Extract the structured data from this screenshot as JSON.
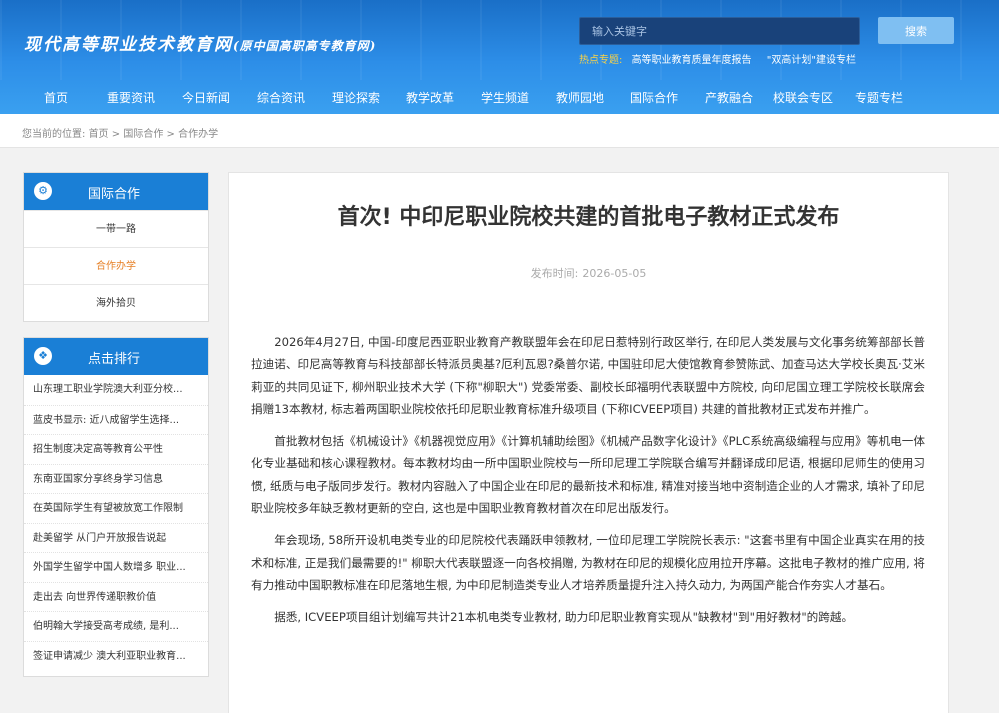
{
  "header": {
    "logo_main": "现代高等职业技术教育网",
    "logo_sub": "(原中国高职高专教育网)",
    "search": {
      "placeholder": "输入关键字",
      "button": "搜索"
    },
    "hot": {
      "label": "热点专题:",
      "links": [
        "高等职业教育质量年度报告",
        "\"双高计划\"建设专栏"
      ]
    },
    "nav": [
      "首页",
      "重要资讯",
      "今日新闻",
      "综合资讯",
      "理论探索",
      "教学改革",
      "学生频道",
      "教师园地",
      "国际合作",
      "产教融合",
      "校联会专区",
      "专题专栏"
    ]
  },
  "breadcrumb": {
    "prefix": "您当前的位置:",
    "items": [
      "首页",
      "国际合作",
      "合作办学"
    ],
    "sep": ">"
  },
  "sidebar": {
    "section1": {
      "icon": "settings-gear-icon",
      "title": "国际合作",
      "items": [
        "一带一路",
        "合作办学",
        "海外拾贝"
      ],
      "active": "合作办学"
    },
    "section2": {
      "icon": "ranking-icon",
      "title": "点击排行",
      "items": [
        "山东理工职业学院澳大利亚分校...",
        "蓝皮书显示: 近八成留学生选择...",
        "招生制度决定高等教育公平性",
        "东南亚国家分享终身学习信息",
        "在英国际学生有望被放宽工作限制",
        "赴美留学 从门户开放报告说起",
        "外国学生留学中国人数增多 职业...",
        "走出去 向世界传递职教价值",
        "伯明翰大学接受高考成绩, 是利...",
        "签证申请减少 澳大利亚职业教育..."
      ]
    }
  },
  "article": {
    "title": "首次! 中印尼职业院校共建的首批电子教材正式发布",
    "date_label": "发布时间:",
    "date": "2026-05-05",
    "paragraphs": [
      "2026年4月27日, 中国-印度尼西亚职业教育产教联盟年会在印尼日惹特别行政区举行, 在印尼人类发展与文化事务统筹部部长普拉迪诺、印尼高等教育与科技部部长特派员奥基?厄利瓦恩?桑普尔诺, 中国驻印尼大使馆教育参赞陈武、加查马达大学校长奥瓦·艾米莉亚的共同见证下, 柳州职业技术大学 (下称\"柳职大\") 党委常委、副校长邱福明代表联盟中方院校, 向印尼国立理工学院校长联席会捐赠13本教材, 标志着两国职业院校依托印尼职业教育标准升级项目 (下称ICVEEP项目) 共建的首批教材正式发布并推广。",
      "首批教材包括《机械设计》《机器视觉应用》《计算机辅助绘图》《机械产品数字化设计》《PLC系统高级编程与应用》等机电一体化专业基础和核心课程教材。每本教材均由一所中国职业院校与一所印尼理工学院联合编写并翻译成印尼语, 根据印尼师生的使用习惯, 纸质与电子版同步发行。教材内容融入了中国企业在印尼的最新技术和标准, 精准对接当地中资制造企业的人才需求, 填补了印尼职业院校多年缺乏教材更新的空白, 这也是中国职业教育教材首次在印尼出版发行。",
      "年会现场, 58所开设机电类专业的印尼院校代表踊跃申领教材, 一位印尼理工学院院长表示: \"这套书里有中国企业真实在用的技术和标准, 正是我们最需要的!\" 柳职大代表联盟逐一向各校捐赠, 为教材在印尼的规模化应用拉开序幕。这批电子教材的推广应用, 将有力推动中国职教标准在印尼落地生根, 为中印尼制造类专业人才培养质量提升注入持久动力, 为两国产能合作夯实人才基石。",
      "据悉, ICVEEP项目组计划编写共计21本机电类专业教材, 助力印尼职业教育实现从\"缺教材\"到\"用好教材\"的跨越。"
    ]
  },
  "colors": {
    "header_blue": "#1a6fc7",
    "side_head": "#1a7fd6",
    "active_orange": "#e67e22",
    "hot_yellow": "#f7d24a"
  }
}
